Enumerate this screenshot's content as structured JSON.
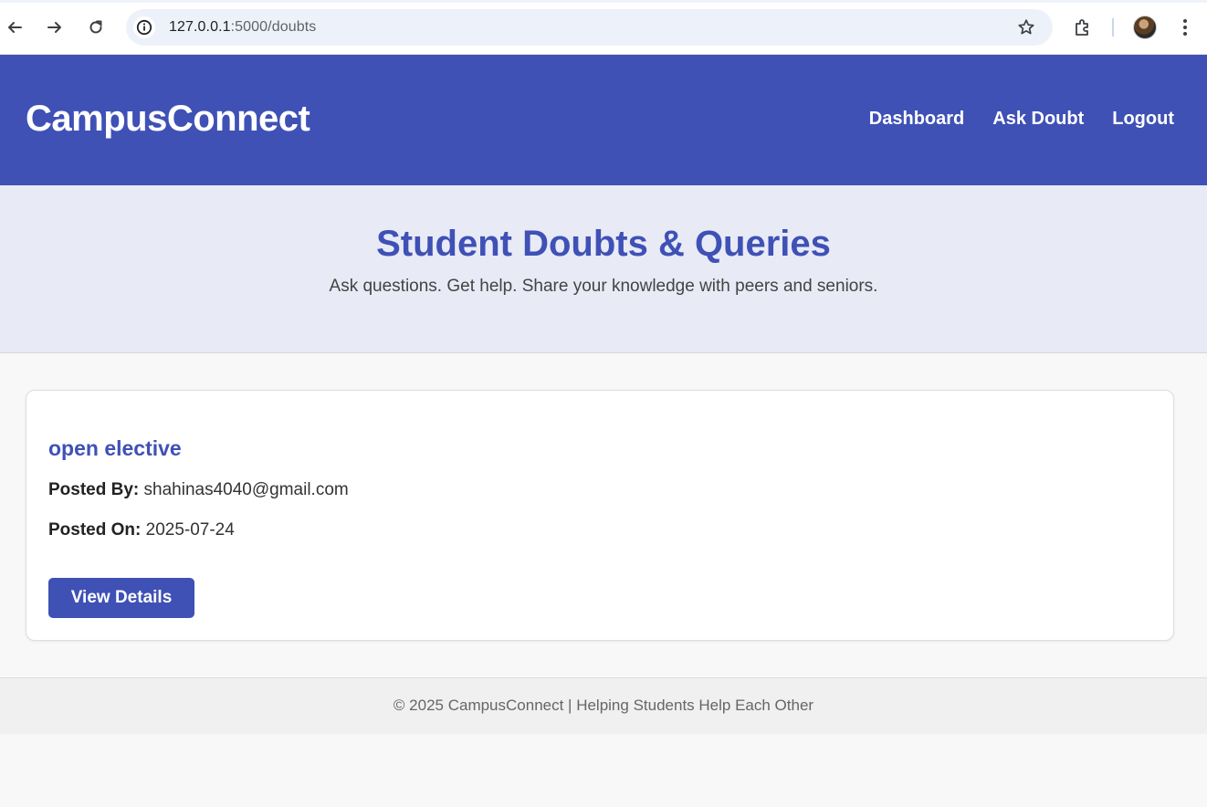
{
  "browser": {
    "url_host": "127.0.0.1",
    "url_rest": ":5000/doubts",
    "icons": [
      "back-arrow-icon",
      "forward-arrow-icon",
      "reload-icon",
      "site-info-icon",
      "bookmark-star-icon",
      "extensions-icon",
      "profile-avatar",
      "more-menu-icon"
    ]
  },
  "header": {
    "brand": "CampusConnect",
    "nav": {
      "dashboard": "Dashboard",
      "ask_doubt": "Ask Doubt",
      "logout": "Logout"
    }
  },
  "hero": {
    "title": "Student Doubts & Queries",
    "subtitle": "Ask questions. Get help. Share your knowledge with peers and seniors."
  },
  "doubts": [
    {
      "title": "open elective",
      "posted_by_label": "Posted By:",
      "posted_by": "shahinas4040@gmail.com",
      "posted_on_label": "Posted On:",
      "posted_on": "2025-07-24",
      "button_label": "View Details"
    }
  ],
  "footer": {
    "text": "© 2025 CampusConnect | Helping Students Help Each Other"
  },
  "colors": {
    "primary": "#3f51b5",
    "hero_bg": "#e8eaf6",
    "page_bg": "#f8f8f8"
  }
}
